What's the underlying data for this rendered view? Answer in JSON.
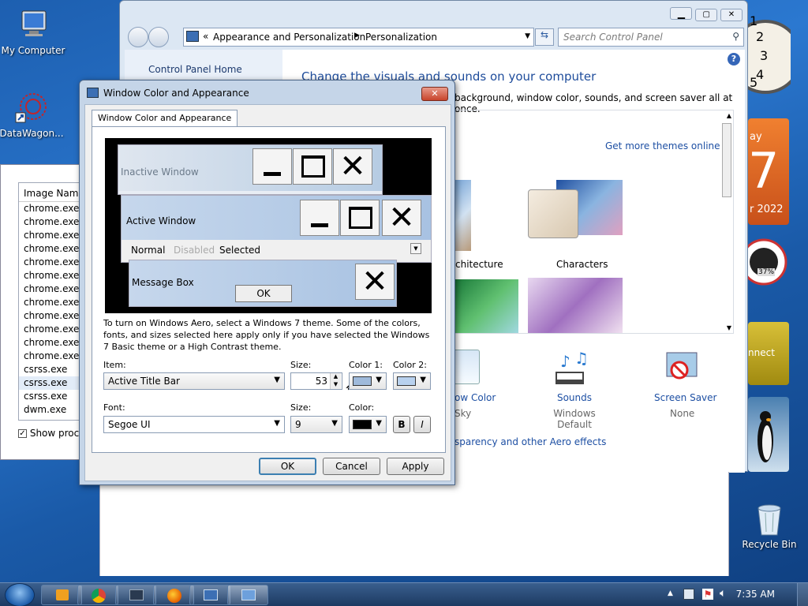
{
  "desktop": {
    "icons": [
      {
        "label": "My Computer",
        "icon": "computer-icon"
      },
      {
        "label": "DataWagon...",
        "icon": "datawagon-icon"
      },
      {
        "label": "Recycle Bin",
        "icon": "recycle-bin-icon"
      }
    ]
  },
  "gadgets": {
    "calendar_day": "7",
    "calendar_weekday": "ay",
    "calendar_month": "r 2022",
    "cpu_percent": "37%",
    "connect_label": "nnect"
  },
  "task_manager": {
    "column_header": "Image Name",
    "processes": [
      "chrome.exe",
      "chrome.exe",
      "chrome.exe",
      "chrome.exe",
      "chrome.exe",
      "chrome.exe",
      "chrome.exe",
      "chrome.exe",
      "chrome.exe",
      "chrome.exe",
      "chrome.exe",
      "chrome.exe",
      "csrss.exe",
      "csrss.exe",
      "csrss.exe",
      "dwm.exe"
    ],
    "selected_index": 13,
    "show_processes_label": "Show proces"
  },
  "control_panel": {
    "breadcrumb_root": "Appearance and Personalization",
    "breadcrumb_current": "Personalization",
    "search_placeholder": "Search Control Panel",
    "home_link": "Control Panel Home",
    "heading": "Change the visuals and sounds on your computer",
    "subheading": "background, window color, sounds, and screen saver all at once.",
    "get_more_themes": "Get more themes online",
    "themes": [
      {
        "label": "chitecture"
      },
      {
        "label": "Characters"
      }
    ],
    "window_color_label": "ow Color",
    "window_color_value": "Sky",
    "sounds_label": "Sounds",
    "sounds_value": "Windows Default",
    "screensaver_label": "Screen Saver",
    "screensaver_value": "None",
    "aero_link": "sparency and other Aero effects"
  },
  "dialog": {
    "title": "Window Color and Appearance",
    "tab": "Window Color and Appearance",
    "preview": {
      "inactive_window": "Inactive Window",
      "active_window": "Active Window",
      "menu_normal": "Normal",
      "menu_disabled": "Disabled",
      "menu_selected": "Selected",
      "message_box": "Message Box",
      "ok_label": "OK"
    },
    "info_text": "To turn on Windows Aero, select a Windows 7 theme.  Some of the colors, fonts, and sizes selected here apply only if you have selected the Windows 7 Basic theme or a High Contrast theme.",
    "item_label": "Item:",
    "item_value": "Active Title Bar",
    "size_label": "Size:",
    "size_value": "53",
    "color1_label": "Color 1:",
    "color2_label": "Color 2:",
    "color1_value": "#9fbadb",
    "color2_value": "#b8d1ee",
    "font_label": "Font:",
    "font_value": "Segoe UI",
    "font_size_label": "Size:",
    "font_size_value": "9",
    "font_color_label": "Color:",
    "font_color_value": "#000000",
    "bold_label": "B",
    "italic_label": "I",
    "ok_button": "OK",
    "cancel_button": "Cancel",
    "apply_button": "Apply"
  },
  "taskbar": {
    "clock": "7:35 AM"
  }
}
